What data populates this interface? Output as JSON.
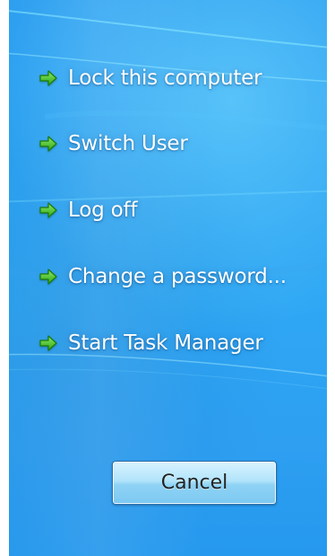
{
  "menu": {
    "items": [
      {
        "label": "Lock this computer",
        "icon": "green-arrow-icon"
      },
      {
        "label": "Switch User",
        "icon": "green-arrow-icon"
      },
      {
        "label": "Log off",
        "icon": "green-arrow-icon"
      },
      {
        "label": "Change a password...",
        "icon": "green-arrow-icon"
      },
      {
        "label": "Start Task Manager",
        "icon": "green-arrow-icon"
      }
    ]
  },
  "buttons": {
    "cancel_label": "Cancel"
  },
  "colors": {
    "background": "#2ca2f2",
    "text": "#ffffff",
    "arrow": "#3fbf1f",
    "button_top": "#d9f3ff",
    "button_bottom": "#7cc8f1"
  }
}
